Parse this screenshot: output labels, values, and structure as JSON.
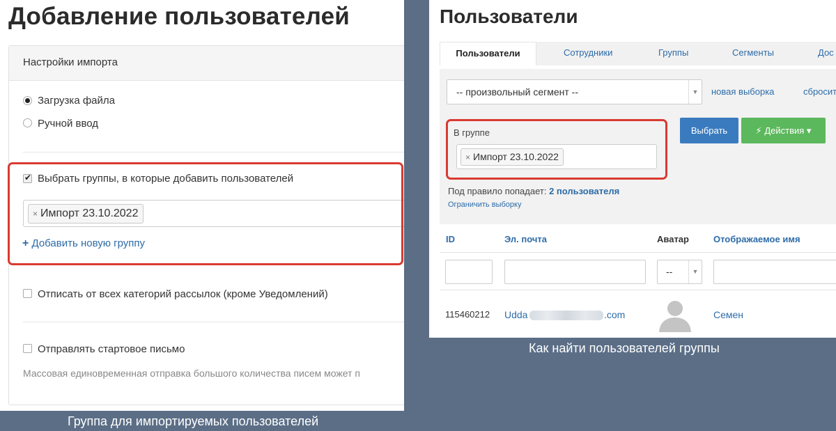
{
  "left": {
    "title": "Добавление пользователей",
    "card_header": "Настройки импорта",
    "radio_file": "Загрузка файла",
    "radio_manual": "Ручной ввод",
    "checkbox_groups": "Выбрать группы, в которые добавить пользователей",
    "tag_remove": "×",
    "group_tag": "Импорт 23.10.2022",
    "add_group_icon": "+",
    "add_group": "Добавить новую группу",
    "checkbox_unsubscribe": "Отписать от всех категорий рассылок (кроме Уведомлений)",
    "checkbox_start_letter": "Отправлять стартовое письмо",
    "note": "Массовая единовременная отправка большого количества писем может п",
    "caption": "Группа для импортируемых пользователей"
  },
  "right": {
    "title": "Пользователи",
    "tabs": [
      "Пользователи",
      "Сотрудники",
      "Группы",
      "Сегменты",
      "Дос"
    ],
    "segment_select": "-- произвольный сегмент --",
    "new_selection": "новая выборка",
    "reset": "сбросить",
    "in_group_label": "В группе",
    "tag_remove": "×",
    "group_tag": "Импорт 23.10.2022",
    "select_button": "Выбрать",
    "actions_button": "Действия",
    "actions_caret": "▾",
    "lightning_icon": "⚡",
    "rule_prefix": "Под правило попадает:",
    "rule_count": "2 пользователя",
    "limit_selection": "Ограничить выборку",
    "columns": [
      "ID",
      "Эл. почта",
      "Аватар",
      "Отображаемое имя"
    ],
    "avatar_filter": "--",
    "row": {
      "id": "115460212",
      "email_start": "Udda",
      "email_end": ".com",
      "name": "Семен"
    },
    "caption": "Как найти пользователей группы"
  },
  "colors": {
    "background": "#5b6e86",
    "highlight": "#d93a31",
    "link": "#2d6ca8",
    "primary_button": "#3a7bbf",
    "success_button": "#5cb85c"
  }
}
